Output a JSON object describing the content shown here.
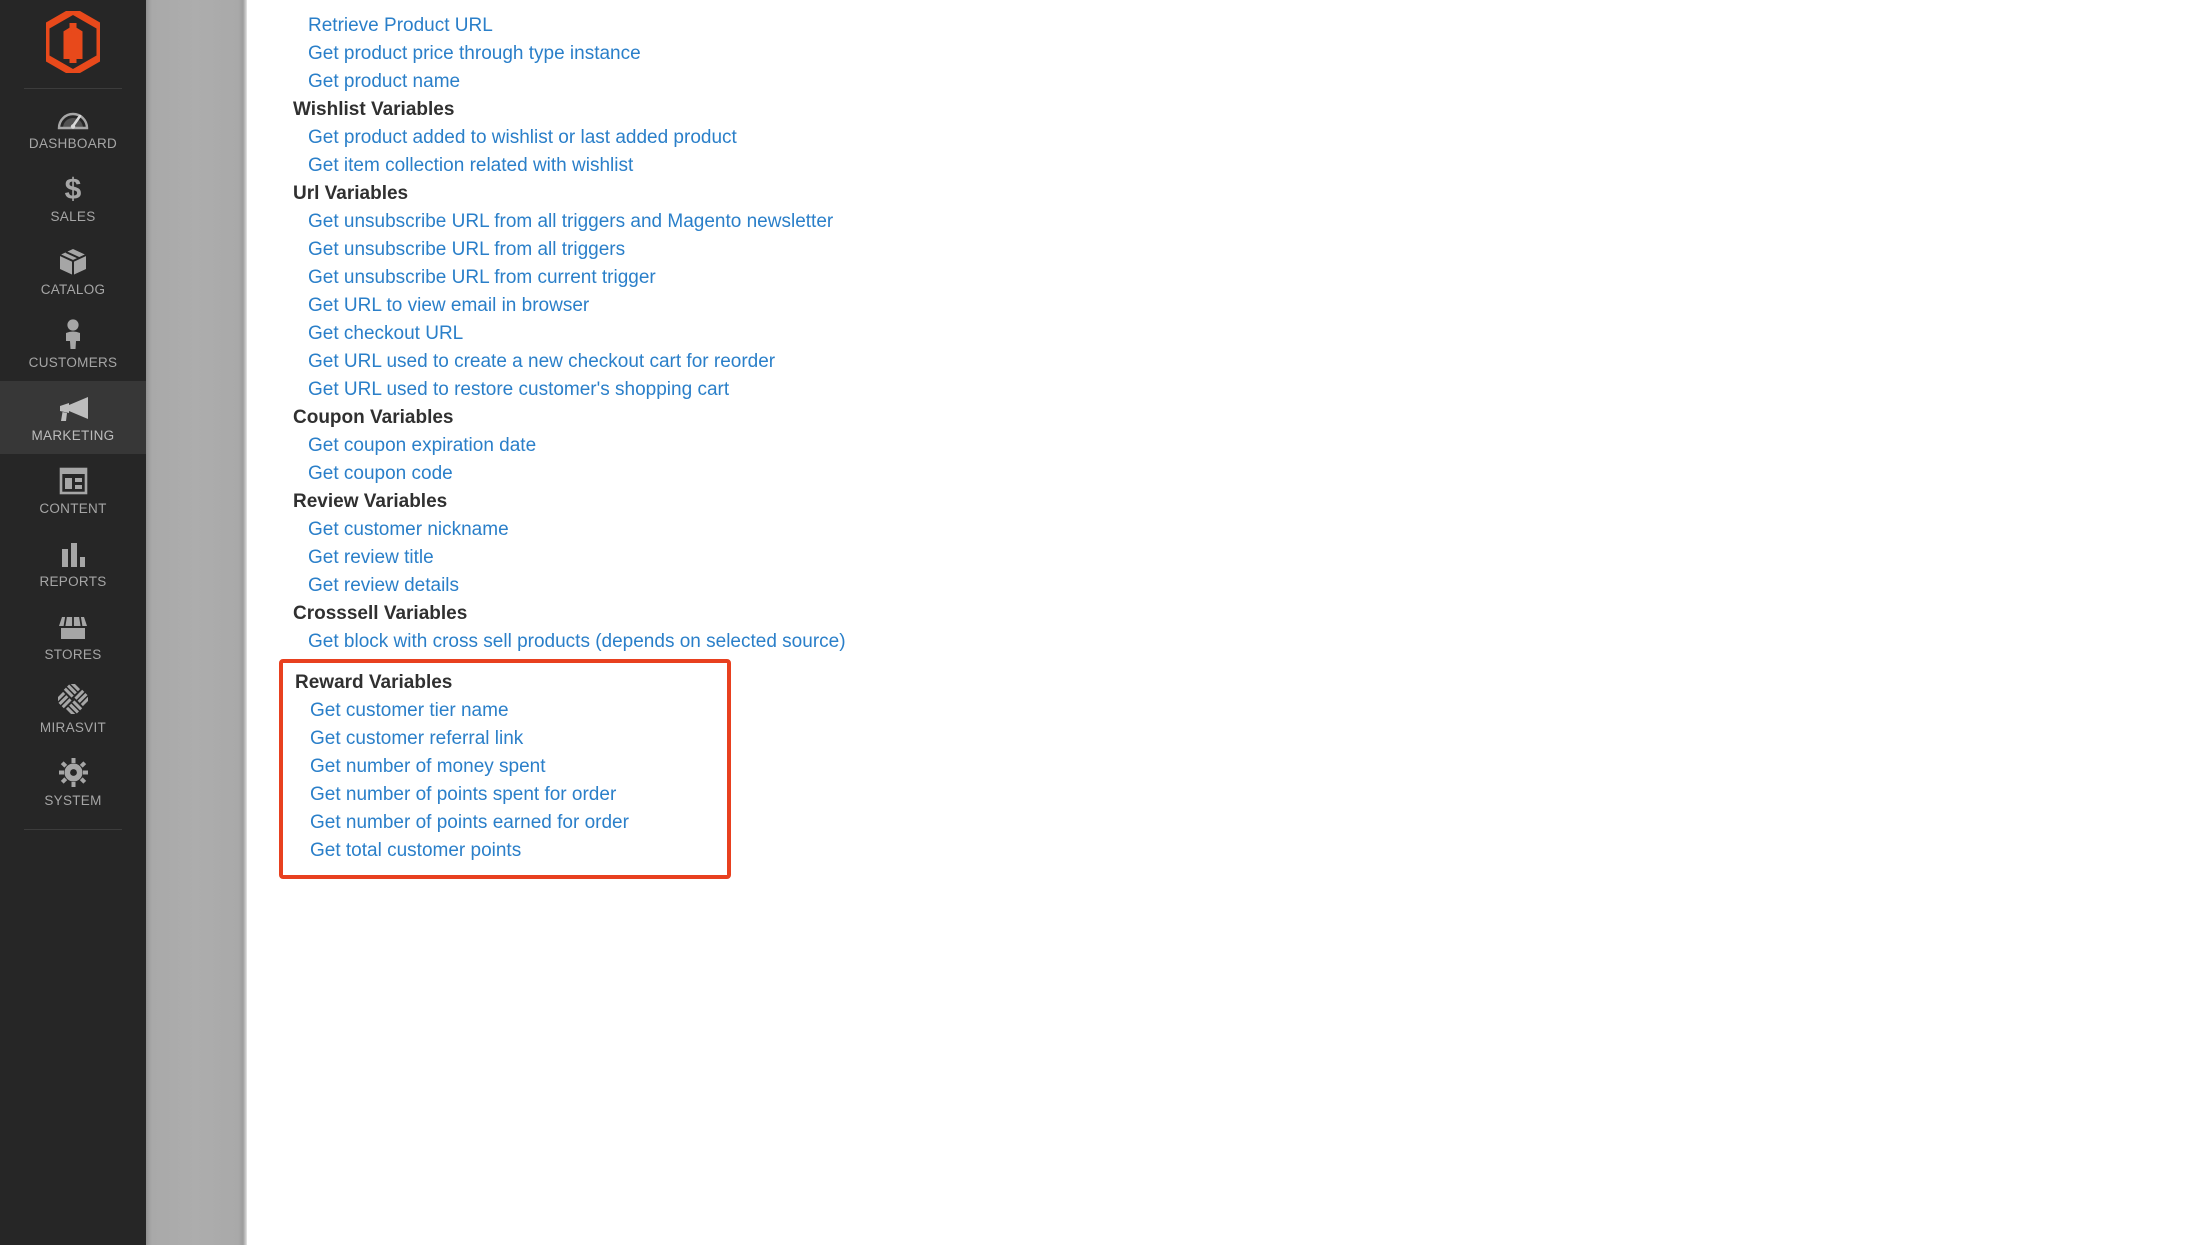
{
  "app": {
    "logo_icon": "magento-logo-icon",
    "brand_color": "#e8491b",
    "link_color": "#2a7fc9",
    "highlight_color": "#e8401f"
  },
  "sidebar": {
    "items": [
      {
        "label": "Dashboard",
        "icon": "gauge-icon",
        "active": false
      },
      {
        "label": "Sales",
        "icon": "dollar-icon",
        "active": false
      },
      {
        "label": "Catalog",
        "icon": "box-icon",
        "active": false
      },
      {
        "label": "Customers",
        "icon": "person-icon",
        "active": false
      },
      {
        "label": "Marketing",
        "icon": "megaphone-icon",
        "active": true
      },
      {
        "label": "Content",
        "icon": "layout-icon",
        "active": false
      },
      {
        "label": "Reports",
        "icon": "bar-chart-icon",
        "active": false
      },
      {
        "label": "Stores",
        "icon": "storefront-icon",
        "active": false
      },
      {
        "label": "Mirasvit",
        "icon": "mirasvit-icon",
        "active": false
      },
      {
        "label": "System",
        "icon": "gear-icon",
        "active": false
      }
    ]
  },
  "main": {
    "orphan_links": [
      "Retrieve Product URL",
      "Get product price through type instance",
      "Get product name"
    ],
    "groups": [
      {
        "title": "Wishlist Variables",
        "highlighted": false,
        "links": [
          "Get product added to wishlist or last added product",
          "Get item collection related with wishlist"
        ]
      },
      {
        "title": "Url Variables",
        "highlighted": false,
        "links": [
          "Get unsubscribe URL from all triggers and Magento newsletter",
          "Get unsubscribe URL from all triggers",
          "Get unsubscribe URL from current trigger",
          "Get URL to view email in browser",
          "Get checkout URL",
          "Get URL used to create a new checkout cart for reorder",
          "Get URL used to restore customer's shopping cart"
        ]
      },
      {
        "title": "Coupon Variables",
        "highlighted": false,
        "links": [
          "Get coupon expiration date",
          "Get coupon code"
        ]
      },
      {
        "title": "Review Variables",
        "highlighted": false,
        "links": [
          "Get customer nickname",
          "Get review title",
          "Get review details"
        ]
      },
      {
        "title": "Crosssell Variables",
        "highlighted": false,
        "links": [
          "Get block with cross sell products (depends on selected source)"
        ]
      },
      {
        "title": "Reward Variables",
        "highlighted": true,
        "links": [
          "Get customer tier name",
          "Get customer referral link",
          "Get number of money spent",
          "Get number of points spent for order",
          "Get number of points earned for order",
          "Get total customer points"
        ]
      }
    ]
  }
}
